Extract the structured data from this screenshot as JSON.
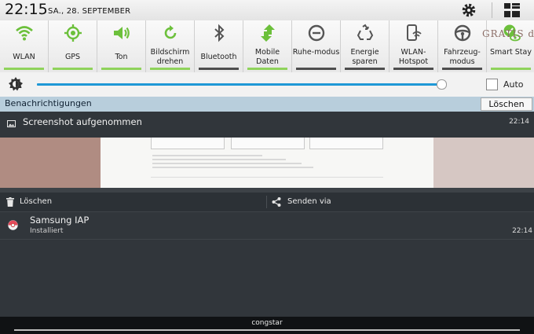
{
  "status": {
    "time": "22:15",
    "date": "SA., 28. SEPTEMBER"
  },
  "toggles": [
    {
      "label": "WLAN",
      "icon": "wifi-icon",
      "on": true
    },
    {
      "label": "GPS",
      "icon": "gps-icon",
      "on": true
    },
    {
      "label": "Ton",
      "icon": "speaker-icon",
      "on": true
    },
    {
      "label": "Bildschirm drehen",
      "icon": "rotate-icon",
      "on": true
    },
    {
      "label": "Bluetooth",
      "icon": "bluetooth-icon",
      "on": false
    },
    {
      "label": "Mobile Daten",
      "icon": "mobile-data-icon",
      "on": true
    },
    {
      "label": "Ruhe-modus",
      "icon": "do-not-disturb-icon",
      "on": false
    },
    {
      "label": "Energie sparen",
      "icon": "recycle-icon",
      "on": false
    },
    {
      "label": "WLAN-Hotspot",
      "icon": "hotspot-icon",
      "on": false
    },
    {
      "label": "Fahrzeug-modus",
      "icon": "steering-wheel-icon",
      "on": false
    },
    {
      "label": "Smart Stay",
      "icon": "smart-stay-icon",
      "on": true
    }
  ],
  "brightness": {
    "level": 0.98,
    "auto_label": "Auto",
    "auto_checked": false
  },
  "notifications": {
    "header": "Benachrichtigungen",
    "clear_label": "Löschen",
    "screenshot": {
      "title": "Screenshot aufgenommen",
      "time": "22:14",
      "preview_text": "GRATIS dc"
    },
    "actions": {
      "delete_label": "Löschen",
      "share_label": "Senden via"
    },
    "samsung_iap": {
      "title": "Samsung IAP",
      "subtitle": "Installiert",
      "time": "22:14"
    }
  },
  "carrier": "congstar",
  "colors": {
    "accent": "#8fd35b",
    "slider": "#1f98d6",
    "panel": "#31363b",
    "header": "#b8cedc"
  }
}
